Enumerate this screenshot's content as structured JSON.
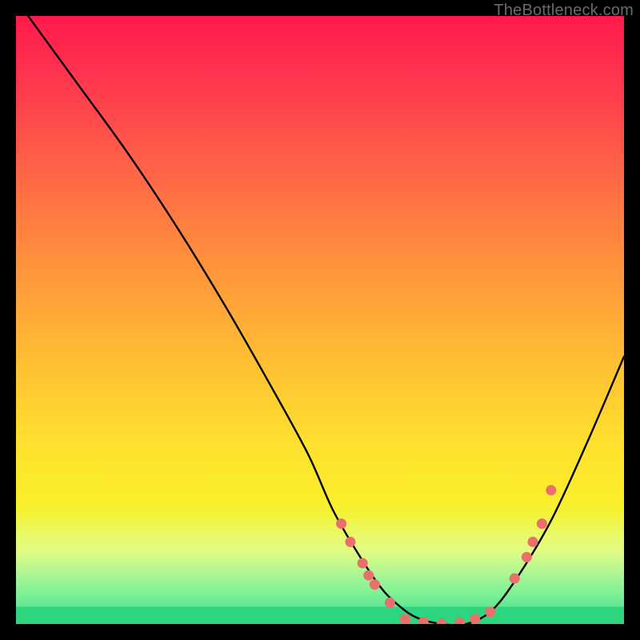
{
  "watermark": "TheBottleneck.com",
  "chart_data": {
    "type": "line",
    "title": "",
    "xlabel": "",
    "ylabel": "",
    "xlim": [
      0,
      100
    ],
    "ylim": [
      0,
      100
    ],
    "grid": false,
    "legend": false,
    "background_gradient": {
      "stops": [
        {
          "pct": 0,
          "color": "#ff1a4b"
        },
        {
          "pct": 22,
          "color": "#ff5a49"
        },
        {
          "pct": 54,
          "color": "#ffb734"
        },
        {
          "pct": 82,
          "color": "#f8f22a"
        },
        {
          "pct": 95,
          "color": "#78f096"
        },
        {
          "pct": 100,
          "color": "#2ed57f"
        }
      ]
    },
    "series": [
      {
        "name": "bottleneck-curve",
        "color": "#000000",
        "x": [
          2,
          10,
          18,
          26,
          34,
          42,
          48,
          52,
          56,
          60,
          63,
          66,
          70,
          74,
          78,
          82,
          88,
          94,
          100
        ],
        "y": [
          100,
          89,
          78,
          66,
          53,
          39,
          28,
          19,
          12,
          6,
          3,
          1,
          0,
          0,
          2,
          7,
          17,
          30,
          44
        ]
      }
    ],
    "points": [
      {
        "name": "markers-left",
        "color": "#e96f6b",
        "x": [
          53.5,
          55.0,
          57.0,
          58.0,
          59.0,
          61.5
        ],
        "y": [
          16.5,
          13.5,
          10.0,
          8.0,
          6.5,
          3.5
        ]
      },
      {
        "name": "markers-bottom",
        "color": "#e96f6b",
        "x": [
          64.0,
          67.0,
          70.0,
          73.0,
          75.5,
          78.0
        ],
        "y": [
          0.8,
          0.3,
          0.0,
          0.2,
          0.8,
          2.0
        ]
      },
      {
        "name": "markers-right",
        "color": "#e96f6b",
        "x": [
          82.0,
          84.0,
          85.0,
          86.5,
          88.0
        ],
        "y": [
          7.5,
          11.0,
          13.5,
          16.5,
          22.0
        ]
      }
    ]
  }
}
